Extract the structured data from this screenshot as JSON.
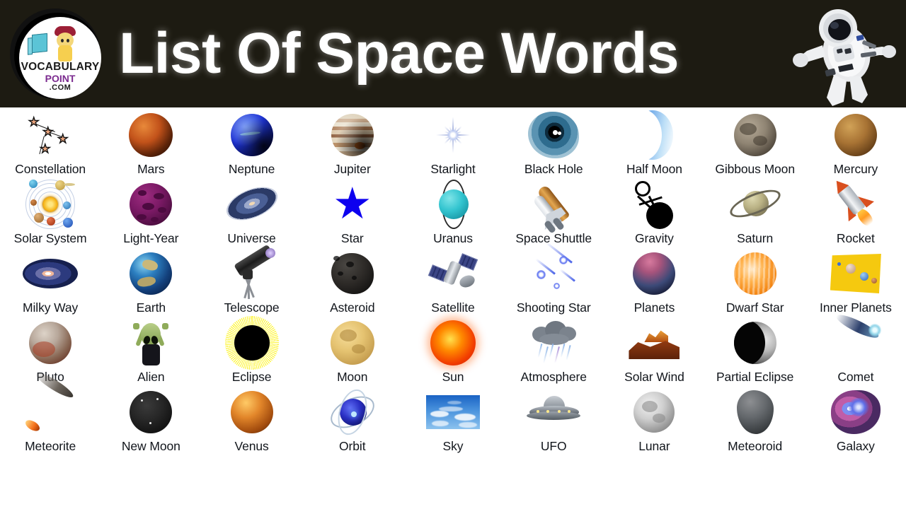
{
  "header": {
    "title": "List Of Space Words",
    "logo": {
      "line1": "VOCABULARY",
      "line2": "POINT",
      "line3": ".COM"
    },
    "astronaut_alt": "astronaut-illustration",
    "background_color": "#1d1b12",
    "title_color": "#ffffff"
  },
  "grid": {
    "columns": 9,
    "label_color": "#12161c",
    "rows": [
      [
        {
          "label": "Constellation",
          "icon": "constellation-icon"
        },
        {
          "label": "Mars",
          "icon": "mars-planet-icon"
        },
        {
          "label": "Neptune",
          "icon": "neptune-planet-icon"
        },
        {
          "label": "Jupiter",
          "icon": "jupiter-planet-icon"
        },
        {
          "label": "Starlight",
          "icon": "starlight-icon"
        },
        {
          "label": "Black Hole",
          "icon": "black-hole-icon"
        },
        {
          "label": "Half Moon",
          "icon": "half-moon-icon"
        },
        {
          "label": "Gibbous Moon",
          "icon": "gibbous-moon-icon"
        },
        {
          "label": "Mercury",
          "icon": "mercury-planet-icon"
        }
      ],
      [
        {
          "label": "Solar System",
          "icon": "solar-system-icon"
        },
        {
          "label": "Light-Year",
          "icon": "light-year-icon"
        },
        {
          "label": "Universe",
          "icon": "universe-icon"
        },
        {
          "label": "Star",
          "icon": "star-icon"
        },
        {
          "label": "Uranus",
          "icon": "uranus-planet-icon"
        },
        {
          "label": "Space Shuttle",
          "icon": "space-shuttle-icon"
        },
        {
          "label": "Gravity",
          "icon": "gravity-icon"
        },
        {
          "label": "Saturn",
          "icon": "saturn-planet-icon"
        },
        {
          "label": "Rocket",
          "icon": "rocket-icon"
        }
      ],
      [
        {
          "label": "Milky Way",
          "icon": "milky-way-icon"
        },
        {
          "label": "Earth",
          "icon": "earth-planet-icon"
        },
        {
          "label": "Telescope",
          "icon": "telescope-icon"
        },
        {
          "label": "Asteroid",
          "icon": "asteroid-icon"
        },
        {
          "label": "Satellite",
          "icon": "satellite-icon"
        },
        {
          "label": "Shooting Star",
          "icon": "shooting-star-icon"
        },
        {
          "label": "Planets",
          "icon": "planets-icon"
        },
        {
          "label": "Dwarf Star",
          "icon": "dwarf-star-icon"
        },
        {
          "label": "Inner Planets",
          "icon": "inner-planets-icon"
        }
      ],
      [
        {
          "label": "Pluto",
          "icon": "pluto-planet-icon"
        },
        {
          "label": "Alien",
          "icon": "alien-icon"
        },
        {
          "label": "Eclipse",
          "icon": "eclipse-icon"
        },
        {
          "label": "Moon",
          "icon": "moon-icon"
        },
        {
          "label": "Sun",
          "icon": "sun-icon"
        },
        {
          "label": "Atmosphere",
          "icon": "atmosphere-icon"
        },
        {
          "label": "Solar Wind",
          "icon": "solar-wind-icon"
        },
        {
          "label": "Partial Eclipse",
          "icon": "partial-eclipse-icon"
        },
        {
          "label": "Comet",
          "icon": "comet-icon"
        }
      ],
      [
        {
          "label": "Meteorite",
          "icon": "meteorite-icon"
        },
        {
          "label": "New Moon",
          "icon": "new-moon-icon"
        },
        {
          "label": "Venus",
          "icon": "venus-planet-icon"
        },
        {
          "label": "Orbit",
          "icon": "orbit-icon"
        },
        {
          "label": "Sky",
          "icon": "sky-icon"
        },
        {
          "label": "UFO",
          "icon": "ufo-icon"
        },
        {
          "label": "Lunar",
          "icon": "lunar-icon"
        },
        {
          "label": "Meteoroid",
          "icon": "meteoroid-icon"
        },
        {
          "label": "Galaxy",
          "icon": "galaxy-icon"
        }
      ]
    ]
  }
}
